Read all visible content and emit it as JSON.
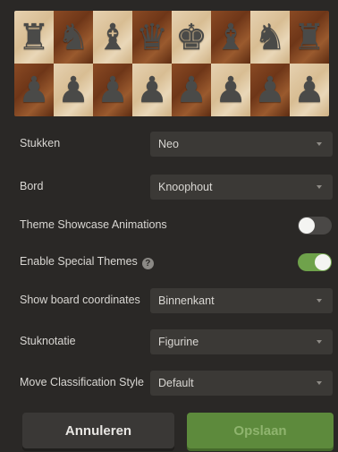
{
  "board_preview": {
    "rows": [
      [
        "♜",
        "♞",
        "♝",
        "♛",
        "♚",
        "♝",
        "♞",
        "♜"
      ],
      [
        "♟",
        "♟",
        "♟",
        "♟",
        "♟",
        "♟",
        "♟",
        "♟"
      ]
    ]
  },
  "settings": [
    {
      "label": "Stukken",
      "type": "select",
      "value": "Neo"
    },
    {
      "label": "Bord",
      "type": "select",
      "value": "Knoophout"
    },
    {
      "label": "Theme Showcase Animations",
      "type": "toggle",
      "on": false
    },
    {
      "label": "Enable Special Themes",
      "type": "toggle",
      "on": true,
      "help": "?"
    },
    {
      "label": "Show board coordinates",
      "type": "select",
      "value": "Binnenkant"
    },
    {
      "label": "Stuknotatie",
      "type": "select",
      "value": "Figurine"
    },
    {
      "label": "Move Classification Style",
      "type": "select",
      "value": "Default"
    }
  ],
  "buttons": {
    "cancel_label": "Annuleren",
    "save_label": "Opslaan"
  },
  "colors": {
    "background": "#2a2826",
    "toggle_on": "#6fa24b",
    "save_button": "#5d8a3c"
  }
}
